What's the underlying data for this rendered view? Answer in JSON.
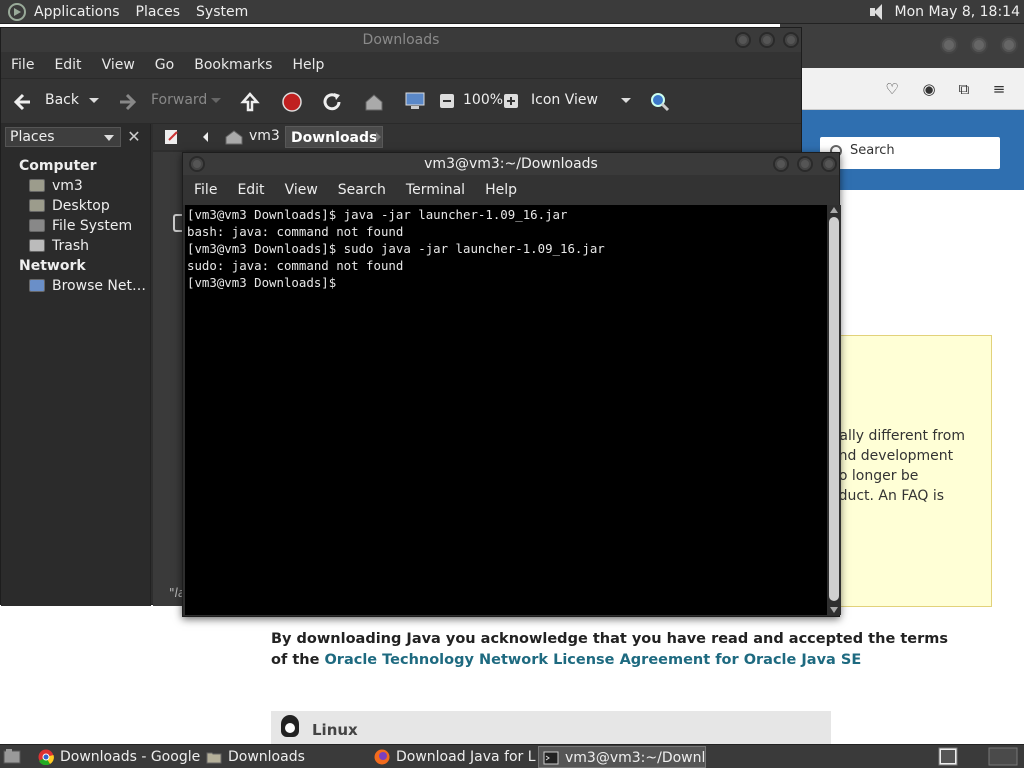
{
  "top_panel": {
    "menus": [
      "Applications",
      "Places",
      "System"
    ],
    "clock": "Mon May  8, 18:14"
  },
  "browser": {
    "search_placeholder": "Search",
    "notice_lines": [
      "tially different from",
      "and development",
      "no longer be",
      "oduct. An FAQ is"
    ],
    "license_text": "By downloading Java you acknowledge that you have read and accepted the terms of the ",
    "license_link": "Oracle Technology Network License Agreement for Oracle Java SE",
    "section_title": "Linux"
  },
  "file_manager": {
    "title": "Downloads",
    "menus": [
      "File",
      "Edit",
      "View",
      "Go",
      "Bookmarks",
      "Help"
    ],
    "toolbar": {
      "back": "Back",
      "forward": "Forward",
      "zoom": "100%",
      "view_mode": "Icon View"
    },
    "sidebar": {
      "combo": "Places",
      "sections": [
        {
          "title": "Computer",
          "items": [
            "vm3",
            "Desktop",
            "File System",
            "Trash"
          ]
        },
        {
          "title": "Network",
          "items": [
            "Browse Net…"
          ]
        }
      ]
    },
    "path": [
      "vm3",
      "Downloads"
    ],
    "status_fragment": "\"la"
  },
  "terminal": {
    "title": "vm3@vm3:~/Downloads",
    "menus": [
      "File",
      "Edit",
      "View",
      "Search",
      "Terminal",
      "Help"
    ],
    "lines": [
      "[vm3@vm3 Downloads]$ java -jar launcher-1.09_16.jar",
      "bash: java: command not found",
      "[vm3@vm3 Downloads]$ sudo java -jar launcher-1.09_16.jar",
      "sudo: java: command not found",
      "[vm3@vm3 Downloads]$"
    ]
  },
  "taskbar": {
    "tasks": [
      "Downloads - Google...",
      "Downloads",
      "Download Java for L...",
      "vm3@vm3:~/Downl..."
    ]
  }
}
